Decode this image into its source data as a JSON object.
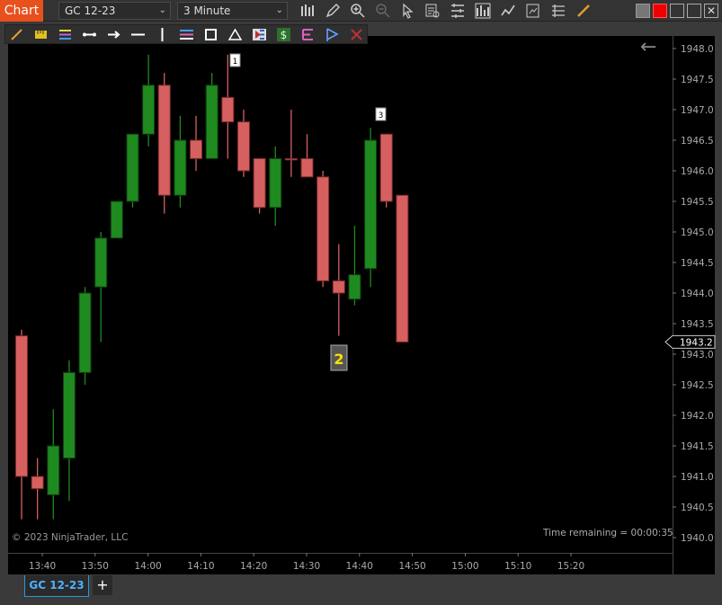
{
  "app": {
    "tab_label": "Chart"
  },
  "toolbar": {
    "instrument": "GC 12-23",
    "interval": "3 Minute",
    "icons": [
      "bars-type-icon",
      "pencil-icon",
      "zoom-in-icon",
      "zoom-out-icon",
      "pointer-icon",
      "data-box-icon",
      "properties-icon",
      "strategies-icon",
      "indicators-icon",
      "templates-icon",
      "grid-icon",
      "ruler-icon"
    ]
  },
  "window": {
    "buttons": [
      "restore-icon",
      "close-red-icon",
      "minimize-icon",
      "maximize-icon",
      "close-icon"
    ]
  },
  "drawing_tools": [
    "line-pencil-icon",
    "ruler-yellow-icon",
    "fibonacci-icon",
    "segment-icon",
    "arrow-line-icon",
    "horizontal-line-icon",
    "vertical-line-icon",
    "channel-icon",
    "rectangle-icon",
    "triangle-icon",
    "region-icon",
    "dollar-icon",
    "pattern-icon",
    "flag-icon",
    "delete-icon"
  ],
  "chart": {
    "copyright": "© 2023 NinjaTrader, LLC",
    "time_remaining": "Time remaining = 00:00:35",
    "last_price": "1943.2",
    "annotations": [
      "1",
      "2",
      "3"
    ]
  },
  "tabs": {
    "active": "GC 12-23",
    "add": "+"
  },
  "colors": {
    "up": "#1f8a1f",
    "down": "#d66060",
    "accent": "#e8501e",
    "tab_accent": "#2a9ad6"
  },
  "chart_data": {
    "type": "candlestick",
    "y_ticks": [
      "1948.0",
      "1947.5",
      "1947.0",
      "1946.5",
      "1946.0",
      "1945.5",
      "1945.0",
      "1944.5",
      "1944.0",
      "1943.5",
      "1943.0",
      "1942.5",
      "1942.0",
      "1941.5",
      "1941.0",
      "1940.5",
      "1940.0"
    ],
    "x_ticks": [
      "13:40",
      "13:50",
      "14:00",
      "14:10",
      "14:20",
      "14:30",
      "14:40",
      "14:50",
      "15:00",
      "15:10",
      "15:20"
    ],
    "candles": [
      {
        "o": 1943.3,
        "h": 1943.4,
        "l": 1940.3,
        "c": 1941.0
      },
      {
        "o": 1941.0,
        "h": 1941.3,
        "l": 1940.3,
        "c": 1940.8
      },
      {
        "o": 1940.7,
        "h": 1942.1,
        "l": 1940.3,
        "c": 1941.5
      },
      {
        "o": 1941.3,
        "h": 1942.9,
        "l": 1940.6,
        "c": 1942.7
      },
      {
        "o": 1942.7,
        "h": 1944.1,
        "l": 1942.5,
        "c": 1944.0
      },
      {
        "o": 1944.1,
        "h": 1945.0,
        "l": 1943.2,
        "c": 1944.9
      },
      {
        "o": 1944.9,
        "h": 1945.5,
        "l": 1944.9,
        "c": 1945.5
      },
      {
        "o": 1945.5,
        "h": 1946.2,
        "l": 1945.4,
        "c": 1946.6
      },
      {
        "o": 1946.6,
        "h": 1947.9,
        "l": 1946.4,
        "c": 1947.4
      },
      {
        "o": 1947.4,
        "h": 1947.6,
        "l": 1945.3,
        "c": 1945.6
      },
      {
        "o": 1945.6,
        "h": 1946.9,
        "l": 1945.4,
        "c": 1946.5
      },
      {
        "o": 1946.5,
        "h": 1946.9,
        "l": 1946.0,
        "c": 1946.2
      },
      {
        "o": 1946.2,
        "h": 1947.6,
        "l": 1946.2,
        "c": 1947.4
      },
      {
        "o": 1947.2,
        "h": 1947.9,
        "l": 1946.2,
        "c": 1946.8
      },
      {
        "o": 1946.8,
        "h": 1947.0,
        "l": 1945.9,
        "c": 1946.0
      },
      {
        "o": 1946.2,
        "h": 1946.2,
        "l": 1945.3,
        "c": 1945.4
      },
      {
        "o": 1945.4,
        "h": 1946.4,
        "l": 1945.1,
        "c": 1946.2
      },
      {
        "o": 1946.2,
        "h": 1947.0,
        "l": 1945.9,
        "c": 1946.2
      },
      {
        "o": 1946.2,
        "h": 1946.6,
        "l": 1945.9,
        "c": 1945.9
      },
      {
        "o": 1945.9,
        "h": 1946.0,
        "l": 1944.1,
        "c": 1944.2
      },
      {
        "o": 1944.2,
        "h": 1944.8,
        "l": 1943.3,
        "c": 1944.0
      },
      {
        "o": 1943.9,
        "h": 1945.1,
        "l": 1943.8,
        "c": 1944.3
      },
      {
        "o": 1944.4,
        "h": 1946.7,
        "l": 1944.1,
        "c": 1946.5
      },
      {
        "o": 1946.6,
        "h": 1946.6,
        "l": 1945.4,
        "c": 1945.5
      },
      {
        "o": 1945.6,
        "h": 1945.6,
        "l": 1943.2,
        "c": 1943.2
      }
    ]
  }
}
